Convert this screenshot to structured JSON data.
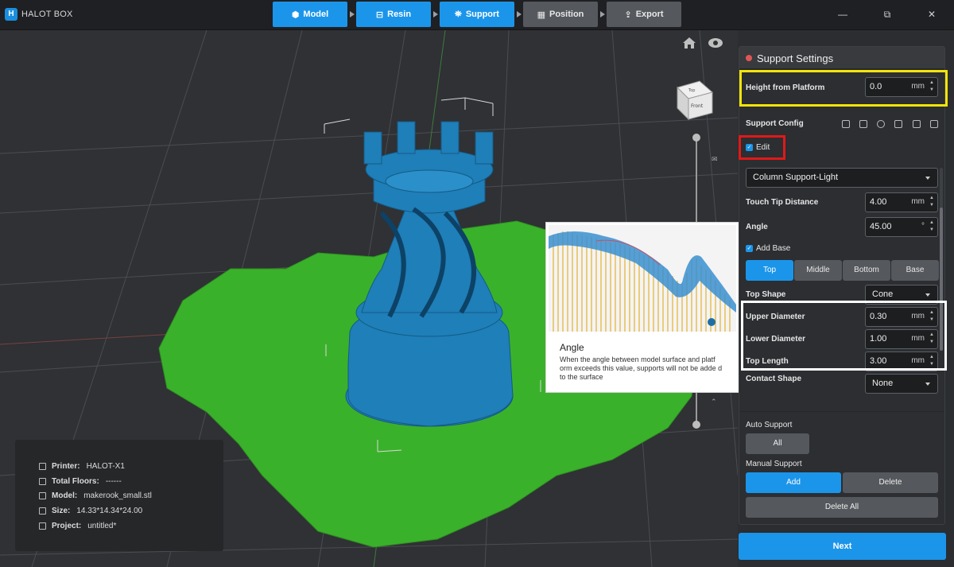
{
  "app": {
    "title": "HALOT BOX",
    "logo_letter": "H"
  },
  "steps": [
    {
      "label": "Model",
      "state": "active"
    },
    {
      "label": "Resin",
      "state": "active"
    },
    {
      "label": "Support",
      "state": "active"
    },
    {
      "label": "Position",
      "state": "inactive"
    },
    {
      "label": "Export",
      "state": "inactive"
    }
  ],
  "window_controls": {
    "minimize": "—",
    "restore": "⧉",
    "close": "✕"
  },
  "viewcube": {
    "top": "Top",
    "front": "Front"
  },
  "tooltip": {
    "title": "Angle",
    "text": "When the angle between model surface and platf orm exceeds this value, supports will not be adde d to the surface"
  },
  "info": {
    "printer_label": "Printer:",
    "printer_value": "HALOT-X1",
    "floors_label": "Total Floors:",
    "floors_value": "------",
    "model_label": "Model:",
    "model_value": "makerook_small.stl",
    "size_label": "Size:",
    "size_value": "14.33*14.34*24.00",
    "project_label": "Project:",
    "project_value": "untitled*"
  },
  "panel": {
    "title": "Support Settings",
    "height_label": "Height from Platform",
    "height_value": "0.0",
    "height_unit": "mm",
    "config_label": "Support Config",
    "edit_label": "Edit",
    "support_type": "Column Support-Light",
    "touch_tip_label": "Touch Tip Distance",
    "touch_tip_value": "4.00",
    "touch_tip_unit": "mm",
    "angle_label": "Angle",
    "angle_value": "45.00",
    "angle_unit": "°",
    "add_base_label": "Add Base",
    "tabs": [
      "Top",
      "Middle",
      "Bottom",
      "Base"
    ],
    "top_shape_label": "Top Shape",
    "top_shape_value": "Cone",
    "upper_label": "Upper Diameter",
    "upper_value": "0.30",
    "upper_unit": "mm",
    "lower_label": "Lower Diameter",
    "lower_value": "1.00",
    "lower_unit": "mm",
    "top_length_label": "Top Length",
    "top_length_value": "3.00",
    "top_length_unit": "mm",
    "contact_label": "Contact Shape",
    "contact_value": "None",
    "auto_label": "Auto Support",
    "all_button": "All",
    "manual_label": "Manual Support",
    "add_button": "Add",
    "delete_button": "Delete",
    "delete_all_button": "Delete All"
  },
  "next_button": "Next",
  "colors": {
    "accent": "#1b95ea",
    "highlight_yellow": "#f5e40a",
    "highlight_red": "#e01919",
    "model": "#1f7fb8",
    "plate": "#3ab12a"
  }
}
